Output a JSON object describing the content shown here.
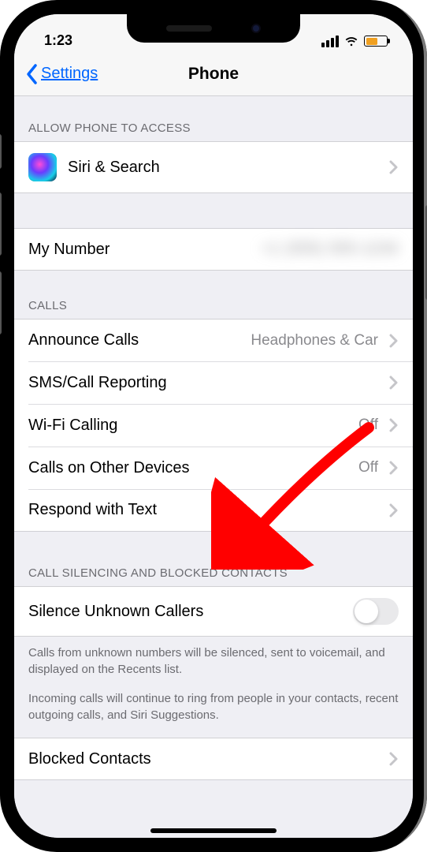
{
  "status": {
    "time": "1:23"
  },
  "nav": {
    "back_label": "Settings",
    "title": "Phone"
  },
  "access_section": {
    "header": "ALLOW PHONE TO ACCESS",
    "siri_label": "Siri & Search"
  },
  "my_number": {
    "label": "My Number",
    "value": "+1 (555) 555-1234"
  },
  "calls_section": {
    "header": "CALLS",
    "announce": {
      "label": "Announce Calls",
      "value": "Headphones & Car"
    },
    "sms": {
      "label": "SMS/Call Reporting"
    },
    "wifi": {
      "label": "Wi-Fi Calling",
      "value": "Off"
    },
    "other_devices": {
      "label": "Calls on Other Devices",
      "value": "Off"
    },
    "respond": {
      "label": "Respond with Text"
    }
  },
  "silencing_section": {
    "header": "CALL SILENCING AND BLOCKED CONTACTS",
    "silence": {
      "label": "Silence Unknown Callers",
      "on": false
    },
    "footnote1": "Calls from unknown numbers will be silenced, sent to voicemail, and displayed on the Recents list.",
    "footnote2": "Incoming calls will continue to ring from people in your contacts, recent outgoing calls, and Siri Suggestions.",
    "blocked": {
      "label": "Blocked Contacts"
    }
  }
}
